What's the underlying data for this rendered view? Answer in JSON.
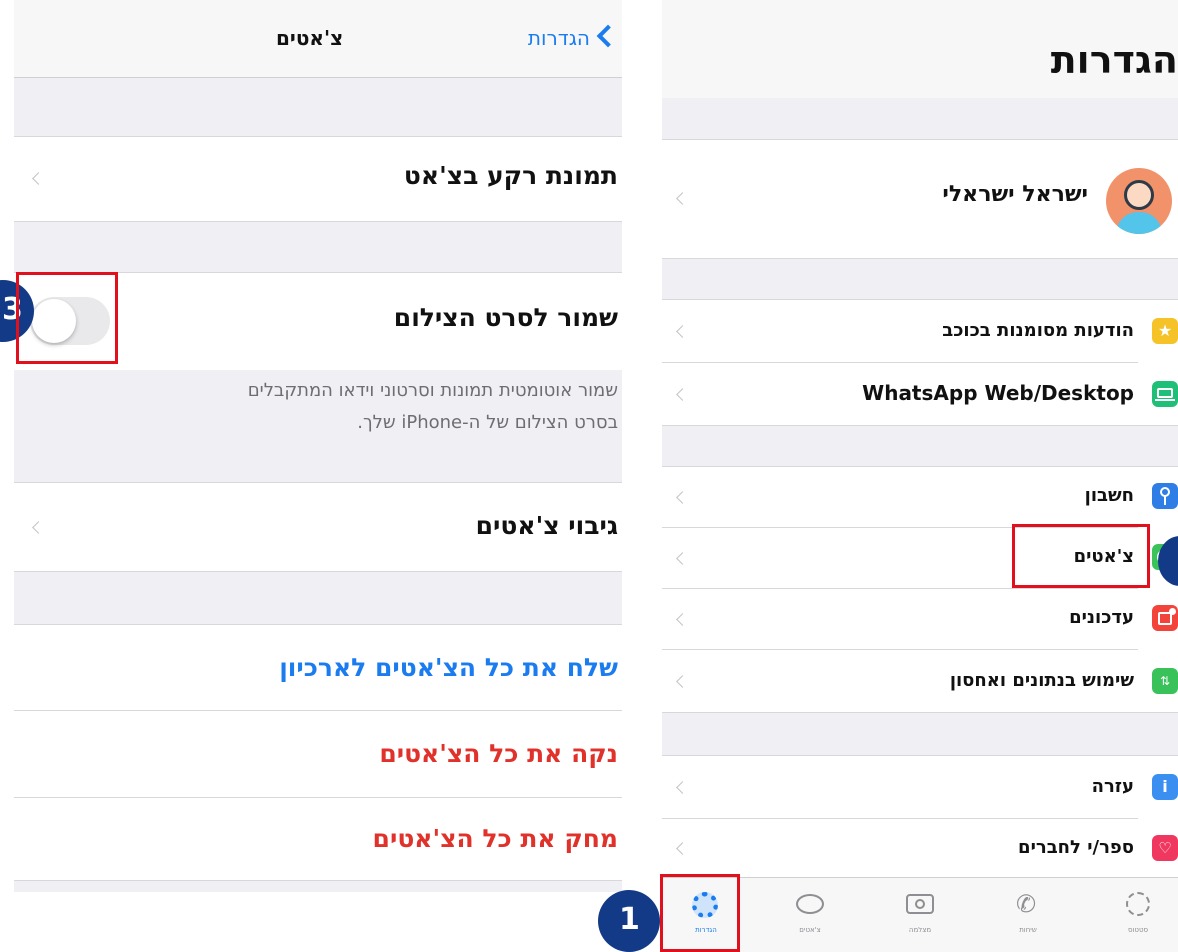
{
  "left_screen": {
    "nav": {
      "back_label": "הגדרות",
      "title": "צ'אטים"
    },
    "rows": {
      "wallpaper": "תמונת רקע בצ'אט",
      "save_to_camera_roll": "שמור לסרט הצילום",
      "save_description_line1": "שמור אוטומטית תמונות וסרטוני וידאו המתקבלים",
      "save_description_line2": "בסרט הצילום של ה-iPhone שלך.",
      "backup": "גיבוי צ'אטים",
      "archive_all": "שלח את כל הצ'אטים לארכיון",
      "clear_all": "נקה את כל הצ'אטים",
      "delete_all": "מחק את כל הצ'אטים"
    },
    "toggle_on": false,
    "step_badge": "3"
  },
  "right_screen": {
    "title": "הגדרות",
    "profile_name": "ישראל ישראלי",
    "items": [
      {
        "label": "הודעות מסומנות בכוכב",
        "icon": "star-icon",
        "color": "#f5c228"
      },
      {
        "label": "WhatsApp Web/Desktop",
        "icon": "laptop-icon",
        "color": "#1fbf78"
      },
      {
        "label": "חשבון",
        "icon": "key-icon",
        "color": "#2f7ee6"
      },
      {
        "label": "צ'אטים",
        "icon": "whatsapp-icon",
        "color": "#3bc35a"
      },
      {
        "label": "עדכונים",
        "icon": "notification-icon",
        "color": "#f2443a"
      },
      {
        "label": "שימוש בנתונים ואחסון",
        "icon": "data-arrows-icon",
        "color": "#39c15a"
      },
      {
        "label": "עזרה",
        "icon": "info-icon",
        "color": "#3b8ff0"
      },
      {
        "label": "ספר/י לחברים",
        "icon": "heart-icon",
        "color": "#f0375f"
      }
    ],
    "tabbar": {
      "settings": "הגדרות",
      "chats": "צ'אטים",
      "camera": "מצלמה",
      "calls": "שיחות",
      "status": "סטטוס"
    },
    "step_badge": "1"
  },
  "colors": {
    "ios_blue": "#1b7cf0",
    "destructive_red": "#e0322b",
    "highlight_red": "#e0101c",
    "badge_navy": "#123a86"
  }
}
